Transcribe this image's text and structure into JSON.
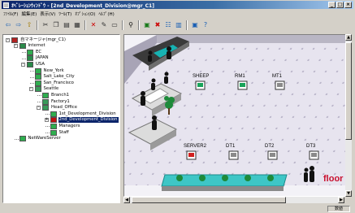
{
  "window": {
    "title": "ｵﾍﾟﾚｰｼｮﾝｳｨﾝﾄﾞｳ - [2nd_Development_Division@mgr_C1]",
    "controls": [
      "_",
      "□",
      "×"
    ]
  },
  "menubar": [
    "ﾌｧｲﾙ(F)",
    "編集(E)",
    "表示(V)",
    "ﾂｰﾙ(T)",
    "ｵﾌﾟｼｮﾝ(O)",
    "ﾍﾙﾌﾟ(H)"
  ],
  "toolbar": [
    {
      "icon": "back-icon",
      "glyph": "⇦"
    },
    {
      "icon": "forward-icon",
      "glyph": "⇨"
    },
    {
      "icon": "up-folder-icon",
      "glyph": "⇧"
    },
    {
      "sep": true
    },
    {
      "icon": "cut-icon",
      "glyph": "✂"
    },
    {
      "icon": "copy-icon",
      "glyph": "❐"
    },
    {
      "icon": "paste-icon",
      "glyph": "▤"
    },
    {
      "icon": "properties-icon",
      "glyph": "▦"
    },
    {
      "sep": true
    },
    {
      "icon": "delete-icon",
      "glyph": "✕"
    },
    {
      "icon": "edit-icon",
      "glyph": "✎"
    },
    {
      "icon": "new-icon",
      "glyph": "▭"
    },
    {
      "sep": true
    },
    {
      "icon": "find-icon",
      "glyph": "⚲"
    },
    {
      "sep": true
    },
    {
      "icon": "map-view-icon",
      "glyph": "▣"
    },
    {
      "icon": "alert-icon",
      "glyph": "✖"
    },
    {
      "icon": "network-icon",
      "glyph": "☷"
    },
    {
      "icon": "list-view-icon",
      "glyph": "▥"
    },
    {
      "sep": true
    },
    {
      "icon": "monitor-icon",
      "glyph": "▣"
    },
    {
      "icon": "help-icon",
      "glyph": "?"
    }
  ],
  "tree": [
    {
      "label": "自マネージャ(mgr_C1)",
      "indent": 0,
      "expander": "-",
      "icon": "manager",
      "selected": false
    },
    {
      "label": "Internet",
      "indent": 1,
      "expander": "-",
      "icon": "folder",
      "selected": false
    },
    {
      "label": "EC",
      "indent": 2,
      "expander": "",
      "icon": "site",
      "selected": false
    },
    {
      "label": "JAPAN",
      "indent": 2,
      "expander": "",
      "icon": "folder",
      "selected": false
    },
    {
      "label": "USA",
      "indent": 2,
      "expander": "-",
      "icon": "folder",
      "selected": false
    },
    {
      "label": "New_York",
      "indent": 3,
      "expander": "",
      "icon": "site",
      "selected": false
    },
    {
      "label": "Salt_Lake_City",
      "indent": 3,
      "expander": "",
      "icon": "site",
      "selected": false
    },
    {
      "label": "San_Francisco",
      "indent": 3,
      "expander": "",
      "icon": "site",
      "selected": false
    },
    {
      "label": "Seattle",
      "indent": 3,
      "expander": "-",
      "icon": "building",
      "selected": false
    },
    {
      "label": "Branch1",
      "indent": 4,
      "expander": "",
      "icon": "site",
      "selected": false
    },
    {
      "label": "Factory1",
      "indent": 4,
      "expander": "",
      "icon": "building",
      "selected": false
    },
    {
      "label": "Head_Office",
      "indent": 4,
      "expander": "-",
      "icon": "building",
      "selected": false
    },
    {
      "label": "1st_Development_Division",
      "indent": 5,
      "expander": "",
      "icon": "site",
      "selected": false
    },
    {
      "label": "2nd_Development_Division",
      "indent": 5,
      "expander": "+",
      "icon": "site-red",
      "selected": true
    },
    {
      "label": "Managers",
      "indent": 5,
      "expander": "",
      "icon": "site",
      "selected": false
    },
    {
      "label": "Staff",
      "indent": 5,
      "expander": "",
      "icon": "site",
      "selected": false
    },
    {
      "label": "NetWareServer",
      "indent": 1,
      "expander": "",
      "icon": "site",
      "selected": false
    }
  ],
  "map": {
    "computers": [
      {
        "label": "SHEEP",
        "kind": "pc-green"
      },
      {
        "label": "RM1",
        "kind": "pc-green"
      },
      {
        "label": "MT1",
        "kind": "pc-gray"
      },
      {
        "label": "SERVER2",
        "kind": "pc-red"
      },
      {
        "label": "DT1",
        "kind": "pc-gray"
      },
      {
        "label": "DT2",
        "kind": "pc-gray"
      },
      {
        "label": "DT3",
        "kind": "pc-gray"
      }
    ],
    "floor_label": "floor",
    "colors": {
      "floor": "#e7e4ef",
      "wall": "#b9b6c4",
      "tile": "#c8c4d6",
      "accent": "#c8102e",
      "water": "#3ec6c6",
      "pc_green": "#19a35a",
      "pc_red": "#d02020"
    }
  },
  "status": {
    "panel": "数値"
  }
}
